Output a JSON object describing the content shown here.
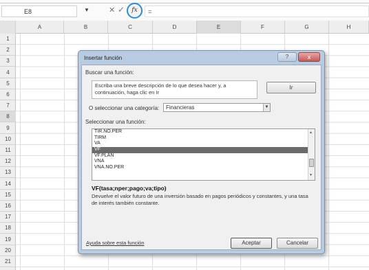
{
  "formula_bar": {
    "name_box": "E8",
    "cancel_glyph": "✕",
    "enter_glyph": "✓",
    "fx_label": "fx",
    "formula": "="
  },
  "columns": [
    "A",
    "B",
    "C",
    "D",
    "E",
    "F",
    "G",
    "H"
  ],
  "active_column": "E",
  "rows": [
    "1",
    "2",
    "3",
    "4",
    "5",
    "6",
    "7",
    "8",
    "9",
    "10",
    "11",
    "12",
    "13",
    "14",
    "15",
    "16",
    "17",
    "18",
    "19",
    "20",
    "21"
  ],
  "active_row": "8",
  "dialog": {
    "title": "Insertar función",
    "help_label": "?",
    "close_label": "x",
    "search_label": "Buscar una función:",
    "search_text": "Escriba una breve descripción de lo que desea hacer y, a continuación, haga clic en Ir",
    "go_label": "Ir",
    "category_label": "O seleccionar una categoría:",
    "category_value": "Financieras",
    "select_label": "Seleccionar una función:",
    "functions": [
      "TIR.NO.PER",
      "TIRM",
      "VA",
      "VF",
      "VF.PLAN",
      "VNA",
      "VNA.NO.PER"
    ],
    "selected_function": "VF",
    "signature": "VF(tasa;nper;pago;va;tipo)",
    "description": "Devuelve el valor futuro de una inversión basado en pagos periódicos y constantes, y una tasa de interés también constante.",
    "help_link": "Ayuda sobre esta función",
    "ok_label": "Aceptar",
    "cancel_label": "Cancelar"
  },
  "icons": {
    "dropdown": "chevron-down-icon",
    "scroll_up": "scroll-up-icon",
    "scroll_down": "scroll-down-icon"
  }
}
